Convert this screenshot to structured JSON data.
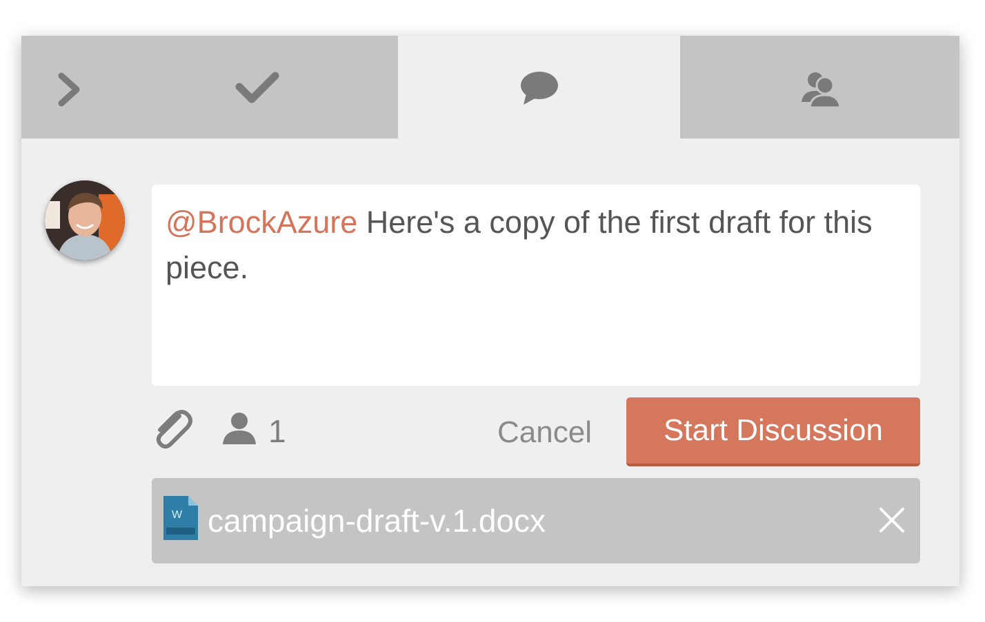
{
  "tabs": [
    {
      "name": "collapse",
      "icon": "chevron-right-icon",
      "active": false
    },
    {
      "name": "tasks",
      "icon": "checkmark-icon",
      "active": false
    },
    {
      "name": "discussion",
      "icon": "speech-bubble-icon",
      "active": true
    },
    {
      "name": "people",
      "icon": "users-icon",
      "active": false
    }
  ],
  "composer": {
    "mention": "@BrockAzure",
    "message": " Here's a copy of the first draft for this piece."
  },
  "toolbar": {
    "attach_icon": "paperclip-icon",
    "participants_icon": "user-icon",
    "participants_count": "1",
    "cancel_label": "Cancel",
    "submit_label": "Start Discussion"
  },
  "attachment": {
    "icon": "word-document-icon",
    "file_name": "campaign-draft-v.1.docx",
    "remove_icon": "close-icon"
  },
  "colors": {
    "accent": "#d4775d",
    "mention": "#d4745a",
    "tab_inactive": "#c4c4c4",
    "panel_bg": "#efefef"
  }
}
